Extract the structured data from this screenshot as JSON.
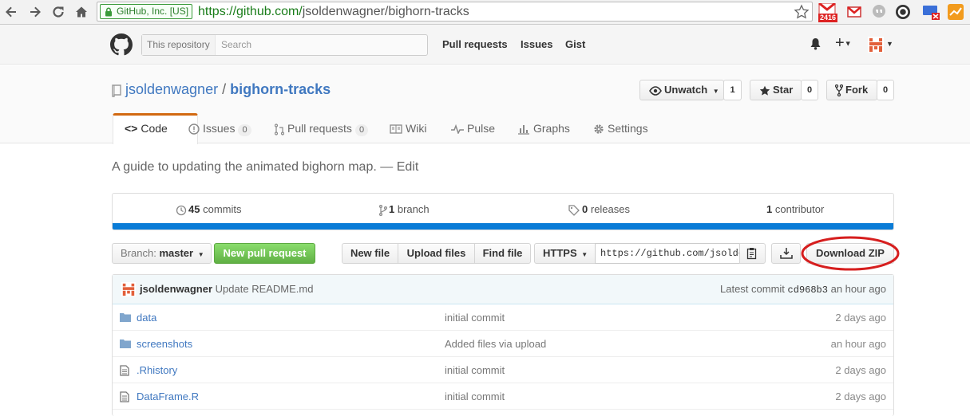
{
  "browser": {
    "secure_label": "GitHub, Inc. [US]",
    "url_host": "https://github.com/",
    "url_path": "jsoldenwagner/bighorn-tracks",
    "gmail_badge": "2416"
  },
  "header": {
    "search_scope": "This repository",
    "search_placeholder": "Search",
    "nav": [
      "Pull requests",
      "Issues",
      "Gist"
    ],
    "plus_label": "+"
  },
  "repo": {
    "owner": "jsoldenwagner",
    "separator": "/",
    "name": "bighorn-tracks",
    "unwatch_label": "Unwatch",
    "watch_count": "1",
    "star_label": "Star",
    "star_count": "0",
    "fork_label": "Fork",
    "fork_count": "0"
  },
  "tabs": {
    "code": "Code",
    "issues": "Issues",
    "issues_count": "0",
    "pulls": "Pull requests",
    "pulls_count": "0",
    "wiki": "Wiki",
    "pulse": "Pulse",
    "graphs": "Graphs",
    "settings": "Settings"
  },
  "description": "A guide to updating the animated bighorn map. — Edit",
  "summary": {
    "commits_num": "45",
    "commits_label": "commits",
    "branch_num": "1",
    "branch_label": "branch",
    "releases_num": "0",
    "releases_label": "releases",
    "contrib_num": "1",
    "contrib_label": "contributor",
    "bar_color": "#0a7cd7"
  },
  "filenav": {
    "branch_prefix": "Branch:",
    "branch_name": "master",
    "new_pr": "New pull request",
    "new_file": "New file",
    "upload": "Upload files",
    "find": "Find file",
    "protocol": "HTTPS",
    "clone_url": "https://github.com/jsoldenwagner/bighorn-tracks.git",
    "download_zip": "Download ZIP"
  },
  "latest_commit": {
    "author": "jsoldenwagner",
    "message": "Update README.md",
    "prefix": "Latest commit",
    "sha": "cd968b3",
    "age": "an hour ago"
  },
  "files": [
    {
      "icon": "folder-icon",
      "name": "data",
      "message": "initial commit",
      "age": "2 days ago"
    },
    {
      "icon": "folder-icon",
      "name": "screenshots",
      "message": "Added files via upload",
      "age": "an hour ago"
    },
    {
      "icon": "file-icon",
      "name": ".Rhistory",
      "message": "initial commit",
      "age": "2 days ago"
    },
    {
      "icon": "file-icon",
      "name": "DataFrame.R",
      "message": "initial commit",
      "age": "2 days ago"
    }
  ]
}
